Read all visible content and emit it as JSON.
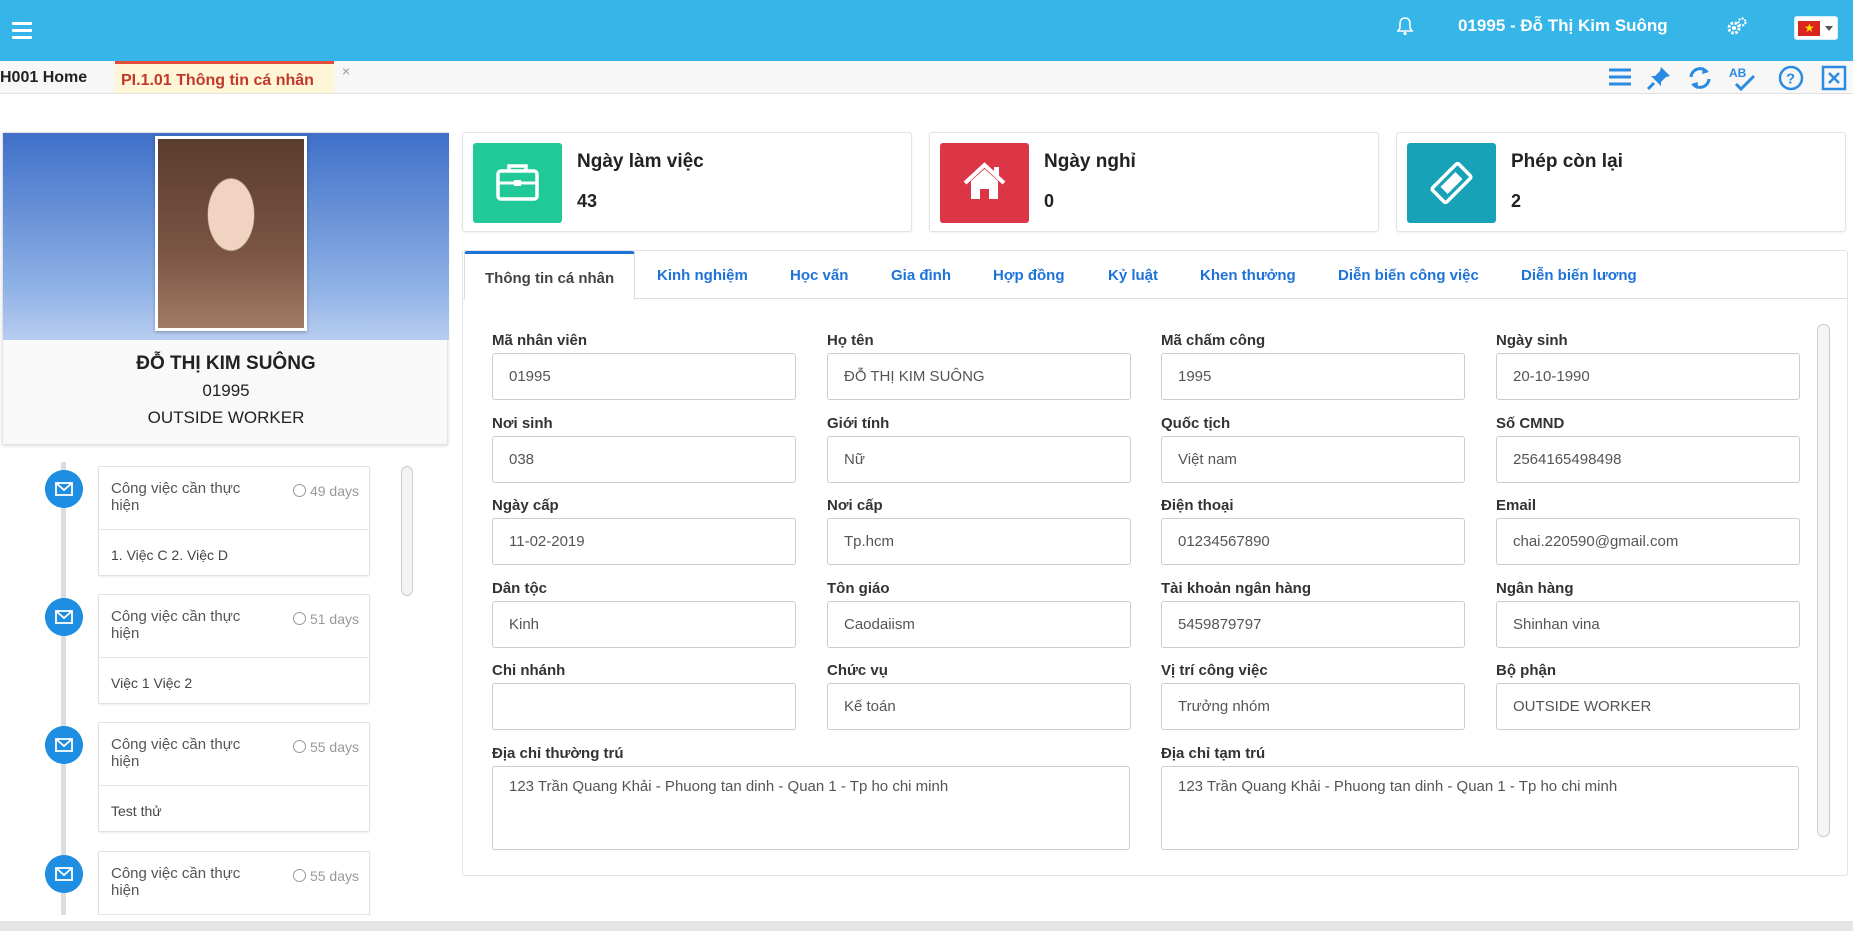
{
  "header": {
    "user_title": "01995 - Đỗ Thị Kim Suông",
    "menu_icon": "hamburger-icon",
    "bell_icon": "bell-icon",
    "settings_icon": "gears-icon",
    "language_icon": "vietnam-flag-icon"
  },
  "tabs": {
    "home": "H001 Home",
    "active": "PI.1.01 Thông tin cá nhân",
    "close_glyph": "×"
  },
  "toolbar_icons": [
    "list-icon",
    "pin-icon",
    "refresh-icon",
    "spellcheck-icon",
    "help-icon",
    "close-window-icon"
  ],
  "profile": {
    "name": "ĐỖ THỊ KIM SUÔNG",
    "code": "01995",
    "department": "OUTSIDE WORKER"
  },
  "timeline": [
    {
      "title": "Công việc cần thực hiện",
      "time": "49 days",
      "body": "1. Việc C 2. Việc D"
    },
    {
      "title": "Công việc cần thực hiện",
      "time": "51 days",
      "body": "Việc 1 Việc 2"
    },
    {
      "title": "Công việc cần thực hiện",
      "time": "55 days",
      "body": "Test thử"
    },
    {
      "title": "Công việc cần thực hiện",
      "time": "55 days",
      "body": ""
    }
  ],
  "stats": [
    {
      "label": "Ngày làm việc",
      "value": "43",
      "color": "#20c997",
      "icon": "briefcase-icon"
    },
    {
      "label": "Ngày nghỉ",
      "value": "0",
      "color": "#dc3545",
      "icon": "home-icon"
    },
    {
      "label": "Phép còn lại",
      "value": "2",
      "color": "#17a2b8",
      "icon": "ticket-icon"
    }
  ],
  "detail_tabs": [
    "Thông tin cá nhân",
    "Kinh nghiệm",
    "Học vấn",
    "Gia đình",
    "Hợp đồng",
    "Kỷ luật",
    "Khen thưởng",
    "Diễn biến công việc",
    "Diễn biến lương"
  ],
  "fields": {
    "ma_nhan_vien": {
      "label": "Mã nhân viên",
      "value": "01995"
    },
    "ho_ten": {
      "label": "Họ tên",
      "value": "ĐỖ THỊ KIM SUÔNG"
    },
    "ma_cham_cong": {
      "label": "Mã chấm công",
      "value": "1995"
    },
    "ngay_sinh": {
      "label": "Ngày sinh",
      "value": "20-10-1990"
    },
    "noi_sinh": {
      "label": "Nơi sinh",
      "value": "038"
    },
    "gioi_tinh": {
      "label": "Giới tính",
      "value": "Nữ"
    },
    "quoc_tich": {
      "label": "Quốc tịch",
      "value": "Việt nam"
    },
    "so_cmnd": {
      "label": "Số CMND",
      "value": "2564165498498"
    },
    "ngay_cap": {
      "label": "Ngày cấp",
      "value": "11-02-2019"
    },
    "noi_cap": {
      "label": "Nơi cấp",
      "value": "Tp.hcm"
    },
    "dien_thoai": {
      "label": "Điện thoại",
      "value": "01234567890"
    },
    "email": {
      "label": "Email",
      "value": "chai.220590@gmail.com"
    },
    "dan_toc": {
      "label": "Dân tộc",
      "value": "Kinh"
    },
    "ton_giao": {
      "label": "Tôn giáo",
      "value": "Caodaiism"
    },
    "tai_khoan": {
      "label": "Tài khoản ngân hàng",
      "value": "5459879797"
    },
    "ngan_hang": {
      "label": "Ngân hàng",
      "value": "Shinhan vina"
    },
    "chi_nhanh": {
      "label": "Chi nhánh",
      "value": ""
    },
    "chuc_vu": {
      "label": "Chức vụ",
      "value": "Kế toán"
    },
    "vi_tri": {
      "label": "Vị trí công việc",
      "value": "Trưởng nhóm"
    },
    "bo_phan": {
      "label": "Bộ phận",
      "value": "OUTSIDE WORKER"
    },
    "dia_chi_thuong_tru": {
      "label": "Địa chỉ thường trú",
      "value": "123 Trần Quang Khải - Phuong tan dinh - Quan 1 - Tp ho chi minh"
    },
    "dia_chi_tam_tru": {
      "label": "Địa chỉ tạm trú",
      "value": "123 Trần Quang Khải - Phuong tan dinh - Quan 1 - Tp ho chi minh"
    }
  }
}
